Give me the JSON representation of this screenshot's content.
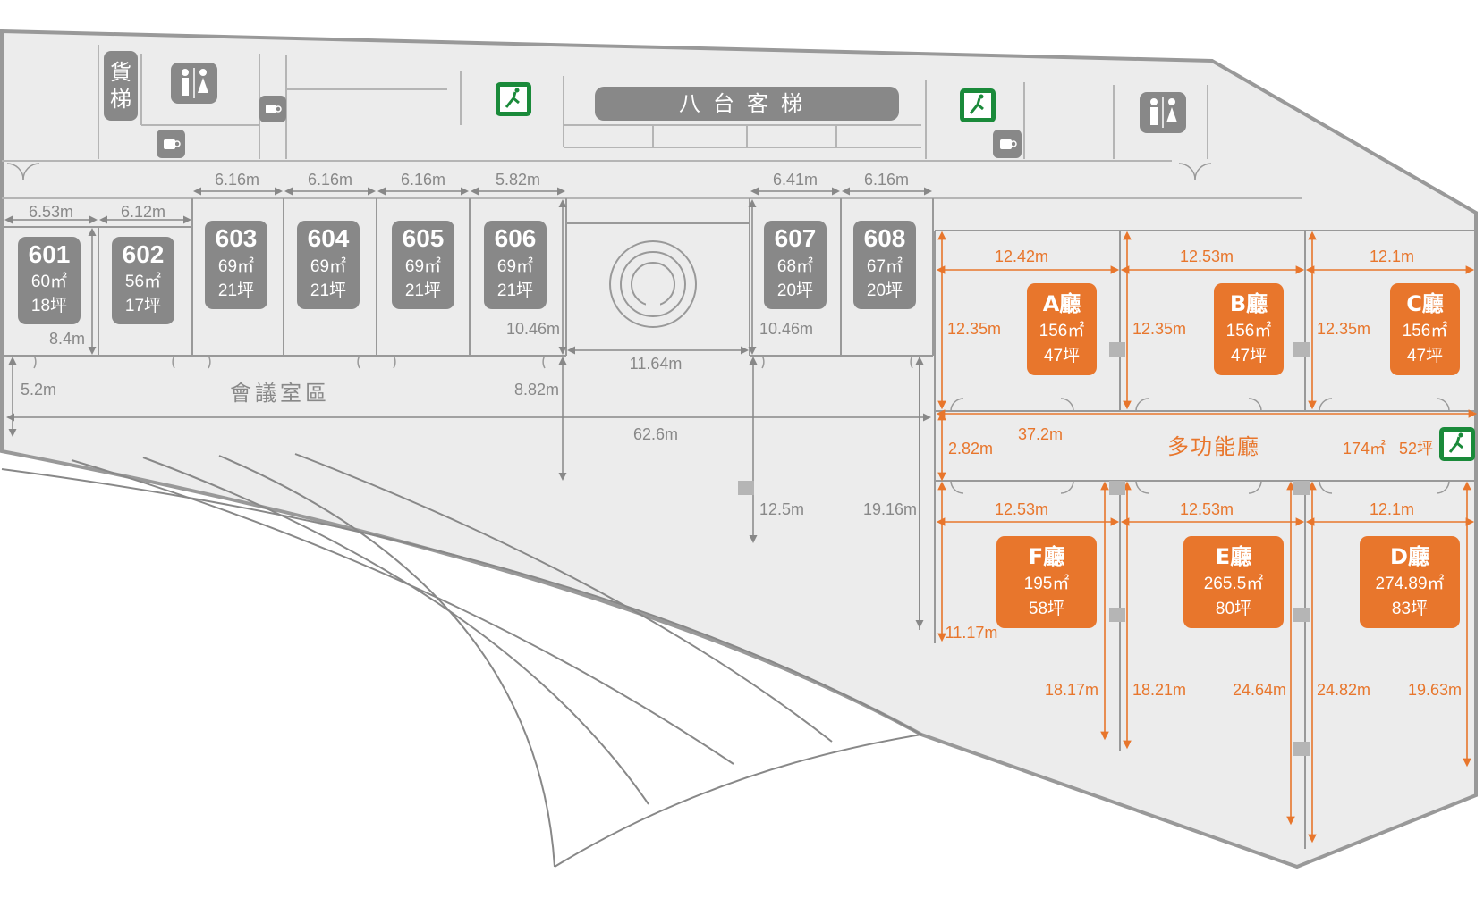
{
  "meeting_rooms": [
    {
      "id": "601",
      "area": "60㎡",
      "ping": "18坪"
    },
    {
      "id": "602",
      "area": "56㎡",
      "ping": "17坪"
    },
    {
      "id": "603",
      "area": "69㎡",
      "ping": "21坪"
    },
    {
      "id": "604",
      "area": "69㎡",
      "ping": "21坪"
    },
    {
      "id": "605",
      "area": "69㎡",
      "ping": "21坪"
    },
    {
      "id": "606",
      "area": "69㎡",
      "ping": "21坪"
    },
    {
      "id": "607",
      "area": "68㎡",
      "ping": "20坪"
    },
    {
      "id": "608",
      "area": "67㎡",
      "ping": "20坪"
    }
  ],
  "halls": [
    {
      "id": "A",
      "name": "A廳",
      "area": "156㎡",
      "ping": "47坪"
    },
    {
      "id": "B",
      "name": "B廳",
      "area": "156㎡",
      "ping": "47坪"
    },
    {
      "id": "C",
      "name": "C廳",
      "area": "156㎡",
      "ping": "47坪"
    },
    {
      "id": "F",
      "name": "F廳",
      "area": "195㎡",
      "ping": "58坪"
    },
    {
      "id": "E",
      "name": "E廳",
      "area": "265.5㎡",
      "ping": "80坪"
    },
    {
      "id": "D",
      "name": "D廳",
      "area": "274.89㎡",
      "ping": "83坪"
    }
  ],
  "labels": {
    "freight_elevator_1": "貨",
    "freight_elevator_2": "梯",
    "elevators": "八台客梯",
    "meeting_zone": "會議室區",
    "multi_hall": "多功能廳",
    "multi_hall_area": "174㎡",
    "multi_hall_ping": "52坪"
  },
  "dims_gray": {
    "d601w": "6.53m",
    "d602w": "6.12m",
    "d603w": "6.16m",
    "d604w": "6.16m",
    "d605w": "6.16m",
    "d606w": "5.82m",
    "d607w": "6.41m",
    "d608w": "6.16m",
    "d602h": "8.4m",
    "d606h": "10.46m",
    "d607h": "10.46m",
    "lobby_w": "11.64m",
    "corr_h": "5.2m",
    "corr2_h": "8.82m",
    "total_w": "62.6m",
    "lobby_h": "12.5m",
    "right_h": "19.16m"
  },
  "dims_orange": {
    "a_w": "12.42m",
    "b_w": "12.53m",
    "c_w": "12.1m",
    "a_h": "12.35m",
    "b_h": "12.35m",
    "c_h": "12.35m",
    "multi_h": "2.82m",
    "multi_w": "37.2m",
    "f_w": "12.53m",
    "e_w": "12.53m",
    "d_w": "12.1m",
    "f_h": "11.17m",
    "f_h2": "18.17m",
    "e_h": "18.21m",
    "e_h2": "24.64m",
    "d_h": "24.82m",
    "d_h2": "19.63m"
  },
  "colors": {
    "accent": "#e8762c",
    "room_gray": "#888888",
    "floor": "#ececec",
    "wall": "#b5b5b5",
    "exit_green": "#1a8a3a"
  },
  "icons": [
    "restroom-icon",
    "coffee-icon",
    "emergency-exit-icon",
    "door-swing-icon",
    "spiral-stair-icon"
  ]
}
